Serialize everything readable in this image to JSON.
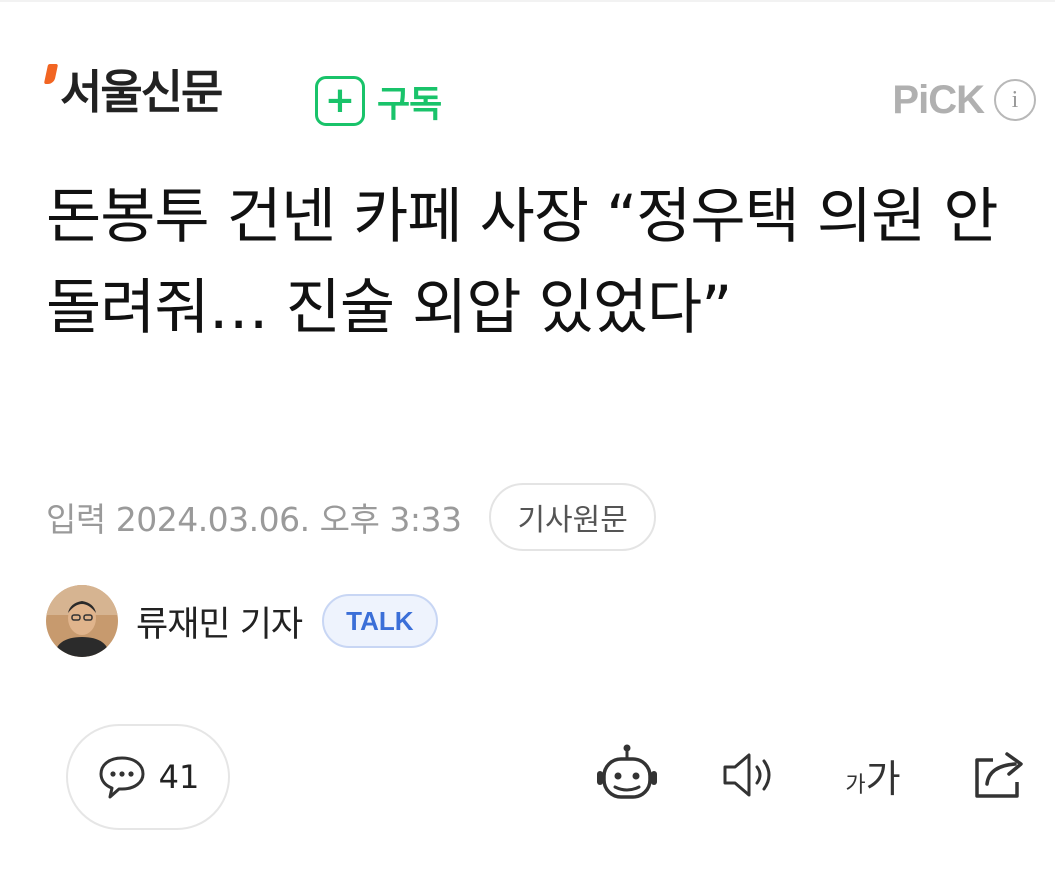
{
  "header": {
    "logo_text": "서울신문",
    "subscribe_label": "구독",
    "pick_label": "PiCK",
    "info_symbol": "i"
  },
  "article": {
    "headline": "돈봉투 건넨 카페 사장 “정우택 의원 안 돌려줘… 진술 외압 있었다”",
    "date": "입력 2024.03.06. 오후 3:33",
    "original_link_label": "기사원문"
  },
  "reporter": {
    "name": "류재민 기자",
    "talk_label": "TALK"
  },
  "toolbar": {
    "comment_count": "41",
    "fontsize_small": "가",
    "fontsize_big": "가"
  },
  "colors": {
    "subscribe_green": "#19c36a",
    "logo_orange": "#f26522",
    "talk_blue": "#3b6fd8",
    "muted_gray": "#9a9a9a"
  },
  "icons": [
    "plus-icon",
    "info-icon",
    "comment-icon",
    "ai-bot-icon",
    "speaker-icon",
    "font-size-icon",
    "share-icon"
  ]
}
